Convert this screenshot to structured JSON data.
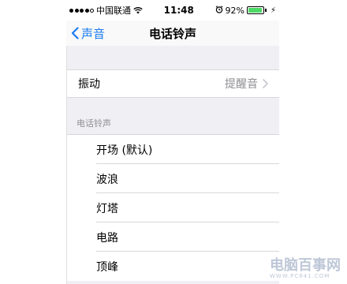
{
  "status_bar": {
    "carrier": "中国联通",
    "time": "11:48",
    "battery_percent_label": "92%",
    "battery_level": 0.92,
    "signal_bars": 4
  },
  "navbar": {
    "back_label": "声音",
    "title": "电话铃声"
  },
  "vibration": {
    "label": "振动",
    "value": "提醒音"
  },
  "ringtones": {
    "section_header": "电话铃声",
    "items": [
      "开场 (默认)",
      "波浪",
      "灯塔",
      "电路",
      "顶峰"
    ]
  },
  "watermark": {
    "text": "电脑百事网",
    "url": "WWW.PC841.COM"
  },
  "colors": {
    "accent": "#1a7cf0",
    "battery": "#4cd964",
    "group_bg": "#efeff4",
    "secondary_text": "#8e8e93"
  }
}
